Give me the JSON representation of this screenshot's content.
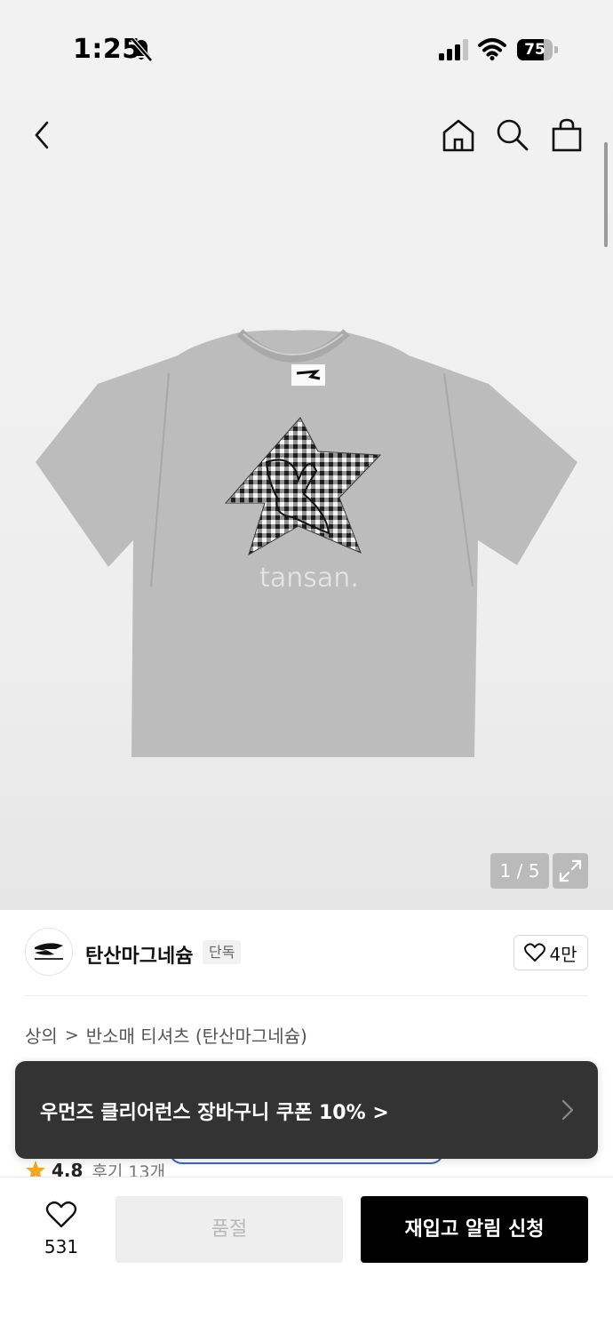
{
  "status_bar": {
    "time": "1:25",
    "battery": "75",
    "battery_level": 0.75
  },
  "nav": {
    "back_icon": "chevron-left-icon",
    "home_icon": "home-icon",
    "search_icon": "search-icon",
    "bag_icon": "shopping-bag-icon"
  },
  "gallery": {
    "shirt_print": "tansan.",
    "page_counter": "1 / 5",
    "current_page": 1,
    "total_pages": 5
  },
  "brand": {
    "name": "탄산마그네슘",
    "tag": "단독",
    "likes": "4만"
  },
  "breadcrumb": {
    "category": "상의",
    "separator": ">",
    "subcategory": "반소매 티셔츠 (탄산마그네슘)"
  },
  "coupon": {
    "text": "우먼즈 클리어런스 장바구니 쿠폰 10% >"
  },
  "rating": {
    "score": "4.8",
    "reviews": "후기 13개",
    "accent_color": "#f5a623"
  },
  "bottom_bar": {
    "wish_count": "531",
    "soldout_label": "품절",
    "restock_label": "재입고 알림 신청"
  }
}
